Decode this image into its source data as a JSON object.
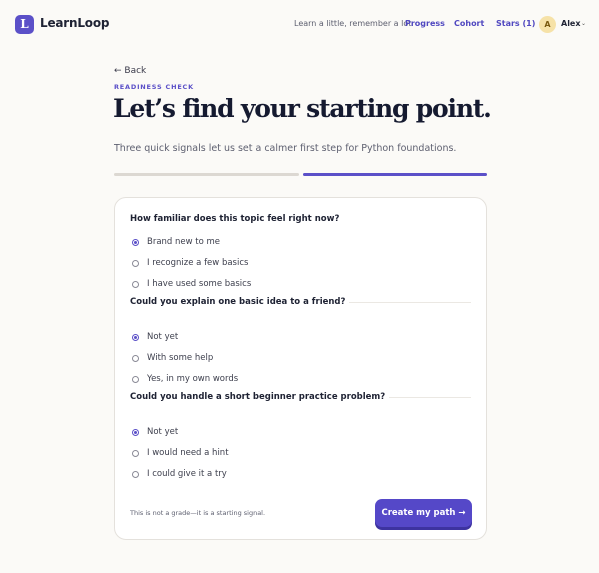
{
  "header": {
    "logo_letter": "L",
    "brand": "LearnLoop",
    "tagline": "Learn a little, remember a lot",
    "nav": [
      {
        "label": "Progress"
      },
      {
        "label": "Cohort"
      },
      {
        "label": "Stars (1)"
      }
    ],
    "user": {
      "initial": "A",
      "name": "Alex",
      "chevron": "⌄"
    }
  },
  "hero": {
    "back": "← Back",
    "eyebrow": "READINESS CHECK",
    "title": "Let’s find your starting point.",
    "subtitle": "Three quick signals let us set a calmer first step for Python foundations."
  },
  "progress": {
    "current_step": 2,
    "total_steps": 2
  },
  "questions": [
    {
      "title": "How familiar does this topic feel right now?",
      "options": [
        "Brand new to me",
        "I recognize a few basics",
        "I have used some basics"
      ],
      "selected": 0
    },
    {
      "title": "Could you explain one basic idea to a friend?",
      "options": [
        "Not yet",
        "With some help",
        "Yes, in my own words"
      ],
      "selected": 0
    },
    {
      "title": "Could you handle a short beginner practice problem?",
      "options": [
        "Not yet",
        "I would need a hint",
        "I could give it a try"
      ],
      "selected": 0
    }
  ],
  "footer": {
    "note": "This is not a grade—it is a starting signal.",
    "cta": "Create my path →"
  },
  "colors": {
    "accent": "#5b50c8",
    "background": "#fbfaf7",
    "track": "#dcd8d2"
  }
}
